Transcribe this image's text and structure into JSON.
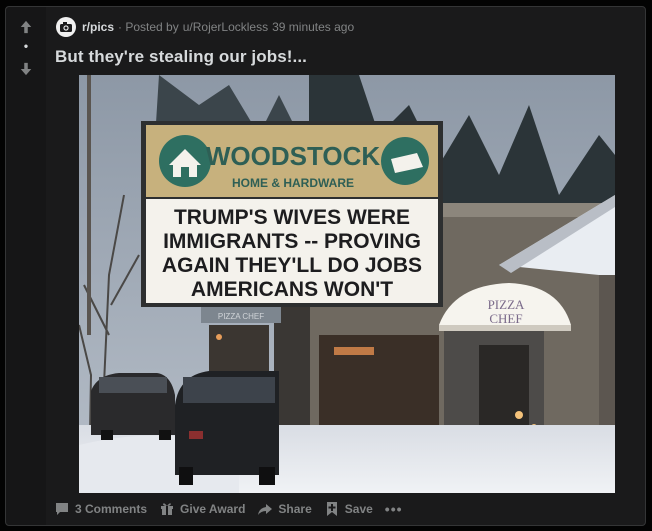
{
  "post": {
    "subreddit": "r/pics",
    "posted_by_prefix": "· Posted by",
    "author": "u/RojerLockless",
    "age": "39 minutes ago",
    "title": "But they're stealing our jobs!...",
    "score": "•"
  },
  "sign": {
    "store_name": "WOODSTOCK",
    "store_sub": "HOME & HARDWARE",
    "line1": "TRUMP'S WIVES WERE",
    "line2": "IMMIGRANTS -- PROVING",
    "line3": "AGAIN THEY'LL DO JOBS",
    "line4": "AMERICANS WON'T",
    "small_sign": "PIZZA CHEF",
    "awning_line1": "PIZZA",
    "awning_line2": "CHEF"
  },
  "actions": {
    "comments": "3 Comments",
    "award": "Give Award",
    "share": "Share",
    "save": "Save",
    "more": "•••"
  },
  "colors": {
    "card_bg": "#1a1a1b",
    "vote_bg": "#161617",
    "text_primary": "#d7dadc",
    "text_muted": "#818384"
  },
  "icons": {
    "upvote": "arrow-up-icon",
    "downvote": "arrow-down-icon",
    "comment": "comment-icon",
    "award": "gift-icon",
    "share": "share-arrow-icon",
    "save": "bookmark-plus-icon",
    "more": "ellipsis-icon"
  }
}
